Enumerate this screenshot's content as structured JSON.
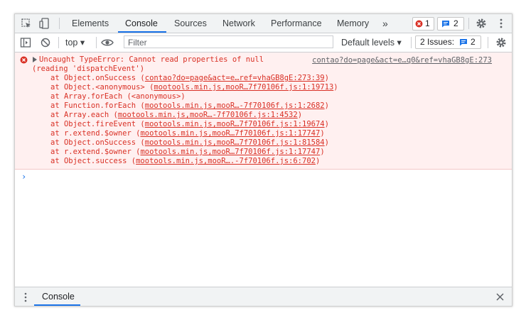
{
  "tabs": [
    {
      "label": "Elements"
    },
    {
      "label": "Console"
    },
    {
      "label": "Sources"
    },
    {
      "label": "Network"
    },
    {
      "label": "Performance"
    },
    {
      "label": "Memory"
    }
  ],
  "more_tabs_glyph": "»",
  "error_count": "1",
  "message_count": "2",
  "toolbar": {
    "context": "top ▾",
    "filter_placeholder": "Filter",
    "levels": "Default levels ▾",
    "issues_label": "2 Issues:",
    "issues_count": "2"
  },
  "error": {
    "title": "Uncaught TypeError: Cannot read properties of null",
    "title2": "(reading 'dispatchEvent')",
    "source": "contao?do=page&act=e…q0&ref=vhaGB8gE:273",
    "stack": [
      {
        "pre": "at Object.onSuccess (",
        "link": "contao?do=page&act=e…ref=vhaGB8gE:273:39",
        "post": ")"
      },
      {
        "pre": "at Object.<anonymous> (",
        "link": "mootools.min.js,mooR…7f70106f.js:1:19713",
        "post": ")"
      },
      {
        "pre": "at Array.forEach (<anonymous>)",
        "link": "",
        "post": ""
      },
      {
        "pre": "at Function.forEach (",
        "link": "mootools.min.js,mooR…-7f70106f.js:1:2682",
        "post": ")"
      },
      {
        "pre": "at Array.each (",
        "link": "mootools.min.js,mooR…-7f70106f.js:1:4532",
        "post": ")"
      },
      {
        "pre": "at Object.fireEvent (",
        "link": "mootools.min.js,mooR…7f70106f.js:1:19674",
        "post": ")"
      },
      {
        "pre": "at r.extend.$owner (",
        "link": "mootools.min.js,mooR…7f70106f.js:1:17747",
        "post": ")"
      },
      {
        "pre": "at Object.onSuccess (",
        "link": "mootools.min.js,mooR…7f70106f.js:1:81584",
        "post": ")"
      },
      {
        "pre": "at r.extend.$owner (",
        "link": "mootools.min.js,mooR…7f70106f.js:1:17747",
        "post": ")"
      },
      {
        "pre": "at Object.success (",
        "link": "mootools.min.js,mooR….-7f70106f.js:6:702",
        "post": ")"
      }
    ]
  },
  "prompt_glyph": "›",
  "drawer": {
    "tab_label": "Console"
  },
  "colors": {
    "accent": "#1a73e8",
    "error": "#d93025",
    "error_bg": "#fff0f0"
  }
}
